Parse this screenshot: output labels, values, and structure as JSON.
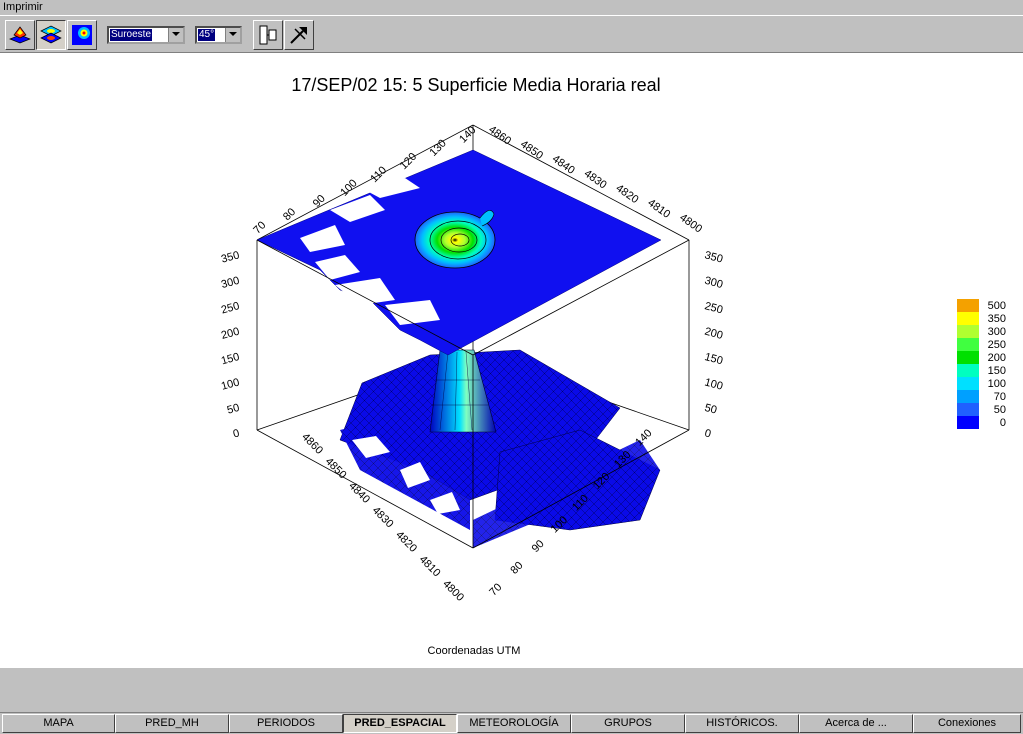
{
  "menu": {
    "print": "Imprimir"
  },
  "toolbar": {
    "view_combo": "Suroeste",
    "angle_combo": "45°",
    "buttons": [
      "surface-3d-icon",
      "contour-layers-icon",
      "color-map-icon",
      "split-view-icon",
      "rotate-tool-icon"
    ]
  },
  "chart": {
    "title": "17/SEP/02 15: 5   Superficie Media Horaria real",
    "xlabel": "Coordenadas UTM"
  },
  "chart_data": {
    "type": "surface3d",
    "title": "17/SEP/02 15: 5   Superficie Media Horaria real",
    "xlabel": "Coordenadas UTM",
    "x_ticks": [
      "70",
      "80",
      "90",
      "100",
      "110",
      "120",
      "130",
      "140"
    ],
    "y_ticks": [
      "4800",
      "4810",
      "4820",
      "4830",
      "4840",
      "4850",
      "4860"
    ],
    "z_ticks": [
      "0",
      "50",
      "100",
      "150",
      "200",
      "250",
      "300",
      "350"
    ],
    "legend": {
      "levels": [
        "500",
        "350",
        "300",
        "250",
        "200",
        "150",
        "100",
        "70",
        "50",
        "0"
      ],
      "colors": [
        "#f4a100",
        "#ffff00",
        "#b0ff30",
        "#40ff40",
        "#00e000",
        "#00ffc0",
        "#00e0ff",
        "#00a0ff",
        "#2060ff",
        "#0000ff"
      ]
    },
    "peak": {
      "x": 110,
      "y": 4840,
      "z": 350
    }
  },
  "tabs": [
    {
      "label": "MAPA"
    },
    {
      "label": "PRED_MH"
    },
    {
      "label": "PERIODOS"
    },
    {
      "label": "PRED_ESPACIAL"
    },
    {
      "label": "METEOROLOGÍA"
    },
    {
      "label": "GRUPOS"
    },
    {
      "label": "HISTÓRICOS."
    },
    {
      "label": "Acerca de ..."
    },
    {
      "label": "Conexiones"
    }
  ]
}
